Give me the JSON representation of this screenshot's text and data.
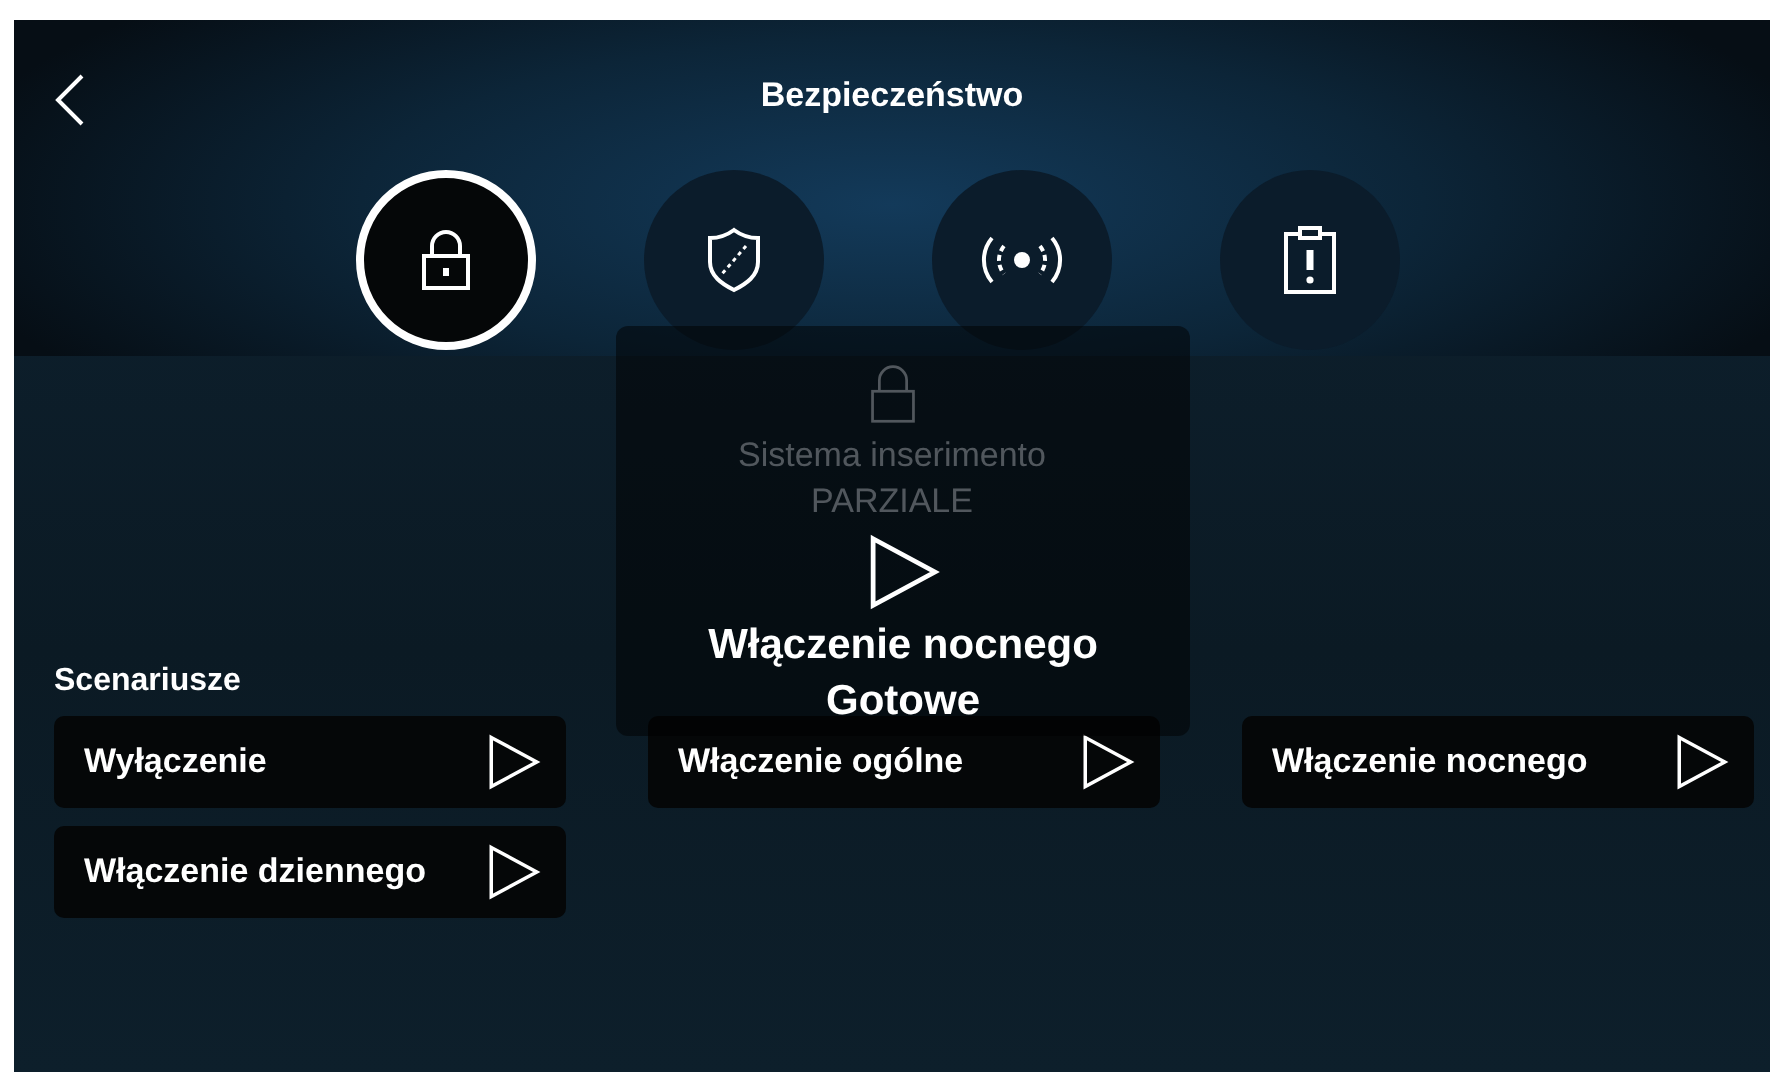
{
  "header": {
    "title": "Bezpieczeństwo"
  },
  "tabs": [
    {
      "kind": "lock",
      "selected": true
    },
    {
      "kind": "shield",
      "selected": false
    },
    {
      "kind": "signal",
      "selected": false
    },
    {
      "kind": "clipboard",
      "selected": false
    }
  ],
  "status": {
    "lines": [
      "Sistema inserimento",
      "PARZIALE"
    ]
  },
  "scenarios": {
    "label": "Scenariusze",
    "items": [
      {
        "label": "Wyłączenie"
      },
      {
        "label": "Włączenie ogólne"
      },
      {
        "label": "Włączenie nocnego"
      },
      {
        "label": "Włączenie dziennego"
      }
    ]
  },
  "popup": {
    "title": "Włączenie nocnego",
    "status": "Gotowe"
  }
}
